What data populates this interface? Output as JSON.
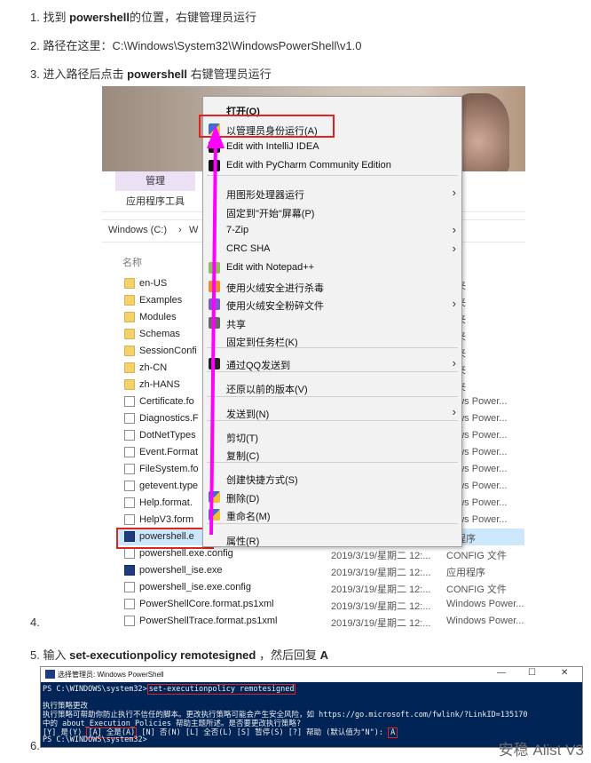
{
  "steps": {
    "s1_num": "1.",
    "s1_pre": "找到 ",
    "s1_bold": "powershell",
    "s1_post": "的位置，右键管理员运行",
    "s2_num": "2.",
    "s2_text": "路径在这里：C:\\Windows\\System32\\WindowsPowerShell\\v1.0",
    "s3_num": "3.",
    "s3_pre": "进入路径后点击 ",
    "s3_bold": "powershell",
    "s3_post": " 右键管理员运行",
    "s4_num": "4.",
    "s5_num": "5.",
    "s5_pre": "输入 ",
    "s5_bold": "set-executionpolicy remotesigned",
    "s5_mid": " ，然后回复 ",
    "s5_bold2": "A",
    "s6_num": "6."
  },
  "explorer": {
    "ribbon_manage": "管理",
    "ribbon_apptools": "应用程序工具",
    "address_root": "Windows (C:)",
    "address_sep": "›",
    "address_next": "W",
    "column_name": "名称",
    "rows": [
      {
        "name": "en-US",
        "kind": "folder",
        "date": "",
        "type": "件夹"
      },
      {
        "name": "Examples",
        "kind": "folder",
        "date": "",
        "type": "件夹"
      },
      {
        "name": "Modules",
        "kind": "folder",
        "date": "",
        "type": "件夹"
      },
      {
        "name": "Schemas",
        "kind": "folder",
        "date": "",
        "type": "件夹"
      },
      {
        "name": "SessionConfi",
        "kind": "folder",
        "date": "",
        "type": "件夹"
      },
      {
        "name": "zh-CN",
        "kind": "folder",
        "date": "",
        "type": "件夹"
      },
      {
        "name": "zh-HANS",
        "kind": "folder",
        "date": "",
        "type": "件夹"
      },
      {
        "name": "Certificate.fo",
        "kind": "file",
        "date": "",
        "type": "dows Power..."
      },
      {
        "name": "Diagnostics.F",
        "kind": "file",
        "date": "",
        "type": "dows Power..."
      },
      {
        "name": "DotNetTypes",
        "kind": "file",
        "date": "",
        "type": "dows Power..."
      },
      {
        "name": "Event.Format",
        "kind": "file",
        "date": "",
        "type": "dows Power..."
      },
      {
        "name": "FileSystem.fo",
        "kind": "file",
        "date": "",
        "type": "dows Power..."
      },
      {
        "name": "getevent.type",
        "kind": "file",
        "date": "",
        "type": "dows Power..."
      },
      {
        "name": "Help.format.",
        "kind": "file",
        "date": "",
        "type": "dows Power..."
      },
      {
        "name": "HelpV3.form",
        "kind": "file",
        "date": "",
        "type": "dows Power..."
      },
      {
        "name": "powershell.e",
        "kind": "ps",
        "date": "",
        "type": "用程序"
      },
      {
        "name": "powershell.exe.config",
        "kind": "file",
        "date": "2019/3/19/星期二 12:...",
        "type": "CONFIG 文件"
      },
      {
        "name": "powershell_ise.exe",
        "kind": "ps",
        "date": "2019/3/19/星期二 12:...",
        "type": "应用程序"
      },
      {
        "name": "powershell_ise.exe.config",
        "kind": "file",
        "date": "2019/3/19/星期二 12:...",
        "type": "CONFIG 文件"
      },
      {
        "name": "PowerShellCore.format.ps1xml",
        "kind": "file",
        "date": "2019/3/19/星期二 12:...",
        "type": "Windows Power..."
      },
      {
        "name": "PowerShellTrace.format.ps1xml",
        "kind": "file",
        "date": "2019/3/19/星期二 12:...",
        "type": "Windows Power..."
      }
    ]
  },
  "context_menu": {
    "items": [
      {
        "label": "打开(O)",
        "icon": "",
        "arrow": ""
      },
      {
        "label": "以管理员身份运行(A)",
        "icon": "shield-icon",
        "arrow": ""
      },
      {
        "label": "Edit with IntelliJ IDEA",
        "icon": "intellij-icon",
        "arrow": ""
      },
      {
        "label": "Edit with PyCharm Community Edition",
        "icon": "pycharm-icon",
        "arrow": ""
      },
      {
        "label": "用图形处理器运行",
        "icon": "",
        "arrow": "›"
      },
      {
        "label": "固定到\"开始\"屏幕(P)",
        "icon": "",
        "arrow": ""
      },
      {
        "label": "7-Zip",
        "icon": "",
        "arrow": "›"
      },
      {
        "label": "CRC SHA",
        "icon": "",
        "arrow": "›"
      },
      {
        "label": "Edit with Notepad++",
        "icon": "notepad-icon",
        "arrow": ""
      },
      {
        "label": "使用火绒安全进行杀毒",
        "icon": "huorong-icon",
        "arrow": ""
      },
      {
        "label": "使用火绒安全粉碎文件",
        "icon": "shredder-icon",
        "arrow": "›"
      },
      {
        "label": "共享",
        "icon": "share-icon",
        "arrow": ""
      },
      {
        "label": "固定到任务栏(K)",
        "icon": "",
        "arrow": ""
      },
      {
        "label": "通过QQ发送到",
        "icon": "qq-icon",
        "arrow": "›"
      },
      {
        "label": "还原以前的版本(V)",
        "icon": "",
        "arrow": ""
      },
      {
        "label": "发送到(N)",
        "icon": "",
        "arrow": "›"
      },
      {
        "label": "剪切(T)",
        "icon": "",
        "arrow": ""
      },
      {
        "label": "复制(C)",
        "icon": "",
        "arrow": ""
      },
      {
        "label": "创建快捷方式(S)",
        "icon": "",
        "arrow": ""
      },
      {
        "label": "删除(D)",
        "icon": "shield-icon",
        "arrow": ""
      },
      {
        "label": "重命名(M)",
        "icon": "shield-icon",
        "arrow": ""
      },
      {
        "label": "属性(R)",
        "icon": "",
        "arrow": ""
      }
    ]
  },
  "console": {
    "title": "选择管理员: Windows PowerShell",
    "win_min": "—",
    "win_max": "☐",
    "win_close": "✕",
    "prompt1": "PS C:\\WINDOWS\\system32>",
    "command": "set-executionpolicy remotesigned",
    "line_title": "执行策略更改",
    "line_body1": "执行策略可帮助你防止执行不信任的脚本。更改执行策略可能会产生安全风险，如 https://go.microsoft.com/fwlink/?LinkID=135170",
    "line_body2": "中的 about_Execution_Policies 帮助主题所述。是否要更改执行策略?",
    "choice_pre": "[Y] 是(Y)  ",
    "choice_a": "[A] 全是(A)",
    "choice_post": "  [N] 否(N)  [L] 全否(L)  [S] 暂停(S)  [?] 帮助 (默认值为\"N\"): ",
    "answer": "A",
    "prompt2": "PS C:\\WINDOWS\\system32>"
  },
  "watermark": "安稳 Alist V3",
  "colors": {
    "highlight": "#e02424",
    "arrow": "#ff00ff",
    "console_bg": "#012456"
  }
}
